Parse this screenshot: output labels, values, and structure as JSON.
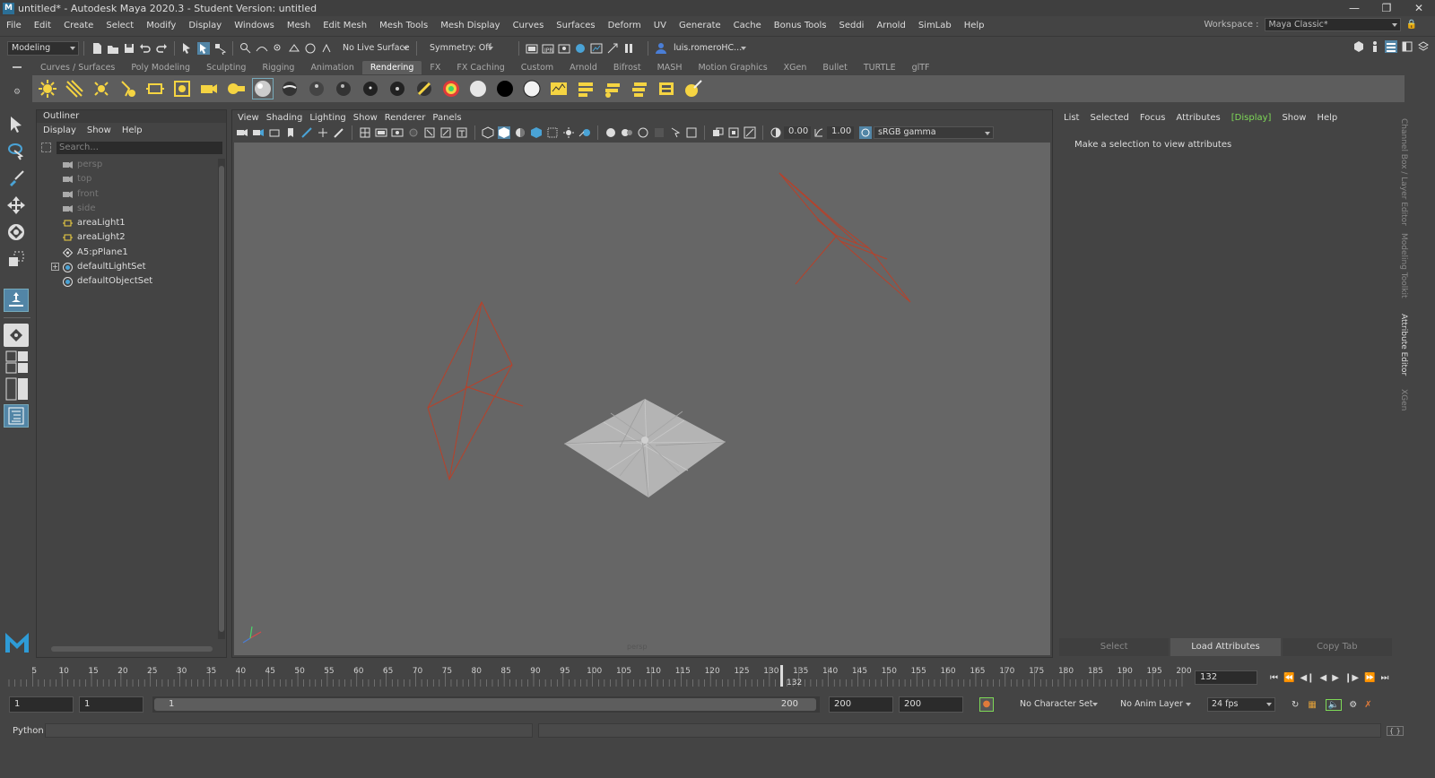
{
  "title": "untitled* - Autodesk Maya 2020.3 - Student Version: untitled",
  "menus": [
    "File",
    "Edit",
    "Create",
    "Select",
    "Modify",
    "Display",
    "Windows",
    "Mesh",
    "Edit Mesh",
    "Mesh Tools",
    "Mesh Display",
    "Curves",
    "Surfaces",
    "Deform",
    "UV",
    "Generate",
    "Cache",
    "Bonus Tools",
    "Seddi",
    "Arnold",
    "SimLab",
    "Help"
  ],
  "workspace": {
    "label": "Workspace :",
    "value": "Maya Classic*"
  },
  "status": {
    "mode": "Modeling",
    "live_surface": "No Live Surface",
    "symmetry": "Symmetry: Off",
    "user": "luis.romeroHC..."
  },
  "shelf_tabs": [
    "Curves / Surfaces",
    "Poly Modeling",
    "Sculpting",
    "Rigging",
    "Animation",
    "Rendering",
    "FX",
    "FX Caching",
    "Custom",
    "Arnold",
    "Bifrost",
    "MASH",
    "Motion Graphics",
    "XGen",
    "Bullet",
    "TURTLE",
    "glTF"
  ],
  "active_shelf_tab": "Rendering",
  "outliner": {
    "title": "Outliner",
    "menu": [
      "Display",
      "Show",
      "Help"
    ],
    "search_placeholder": "Search...",
    "items": [
      {
        "label": "persp",
        "icon": "camera-icon",
        "dim": true
      },
      {
        "label": "top",
        "icon": "camera-icon",
        "dim": true
      },
      {
        "label": "front",
        "icon": "camera-icon",
        "dim": true
      },
      {
        "label": "side",
        "icon": "camera-icon",
        "dim": true
      },
      {
        "label": "areaLight1",
        "icon": "area-light-icon",
        "dim": false
      },
      {
        "label": "areaLight2",
        "icon": "area-light-icon",
        "dim": false
      },
      {
        "label": "A5:pPlane1",
        "icon": "transform-icon",
        "dim": false
      },
      {
        "label": "defaultLightSet",
        "icon": "set-icon",
        "dim": false,
        "expandable": true
      },
      {
        "label": "defaultObjectSet",
        "icon": "set-icon",
        "dim": false
      }
    ]
  },
  "viewport": {
    "menu": [
      "View",
      "Shading",
      "Lighting",
      "Show",
      "Renderer",
      "Panels"
    ],
    "exposure": "0.00",
    "gamma": "1.00",
    "color_space": "sRGB gamma",
    "camera_label": "persp"
  },
  "attribute_editor": {
    "menu": [
      "List",
      "Selected",
      "Focus",
      "Attributes",
      "[Display]",
      "Show",
      "Help"
    ],
    "message": "Make a selection to view attributes",
    "buttons": [
      "Select",
      "Load Attributes",
      "Copy Tab"
    ]
  },
  "side_tabs": [
    "Channel Box / Layer Editor",
    "Modeling Toolkit",
    "Attribute Editor",
    "XGen"
  ],
  "timeslider": {
    "ticks": [
      5,
      10,
      15,
      20,
      25,
      30,
      35,
      40,
      45,
      50,
      55,
      60,
      65,
      70,
      75,
      80,
      85,
      90,
      95,
      100,
      105,
      110,
      115,
      120,
      125,
      130,
      135,
      140,
      145,
      150,
      155,
      160,
      165,
      170,
      175,
      180,
      185,
      190,
      195,
      200
    ],
    "current_frame": "132",
    "current_frame_field": "132",
    "min": 1,
    "max": 200
  },
  "range": {
    "start": "1",
    "anim_start": "1",
    "slider_start": "1",
    "slider_end": "200",
    "anim_end": "200",
    "end": "200",
    "character_set": "No Character Set",
    "anim_layer": "No Anim Layer",
    "fps": "24 fps"
  },
  "command_line": {
    "label": "Python"
  },
  "colors": {
    "accent": "#5285a6",
    "viewport_bg": "#666666",
    "light_wire": "#b8412a",
    "display_highlight": "#7ed957"
  }
}
